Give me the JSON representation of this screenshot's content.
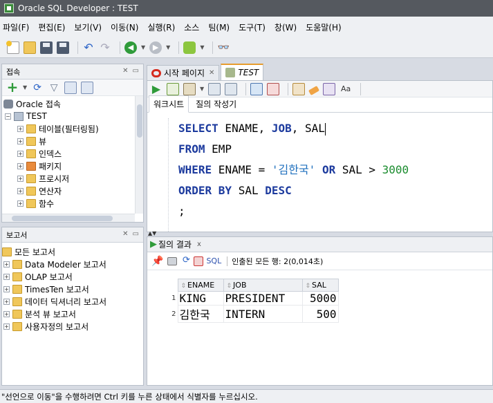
{
  "window": {
    "title": "Oracle SQL Developer : TEST"
  },
  "menu": [
    "파일(F)",
    "편집(E)",
    "보기(V)",
    "이동(N)",
    "실행(R)",
    "소스",
    "팀(M)",
    "도구(T)",
    "창(W)",
    "도움말(H)"
  ],
  "connections_panel": {
    "title": "접속",
    "root": "Oracle 접속",
    "connection": "TEST",
    "items": [
      "테이블(필터링됨)",
      "뷰",
      "인덱스",
      "패키지",
      "프로시저",
      "연산자",
      "함수"
    ]
  },
  "reports_panel": {
    "title": "보고서",
    "root": "모든 보고서",
    "items": [
      "Data Modeler 보고서",
      "OLAP 보고서",
      "TimesTen 보고서",
      "데이터 딕셔너리 보고서",
      "분석 뷰 보고서",
      "사용자정의 보고서"
    ]
  },
  "doc_tabs": [
    {
      "label": "시작 페이지",
      "active": false
    },
    {
      "label": "TEST",
      "active": true
    }
  ],
  "sub_tabs": {
    "worksheet": "워크시트",
    "query_builder": "질의 작성기"
  },
  "editor": {
    "line1": {
      "kw1": "SELECT",
      "t1": " ENAME, ",
      "kw2": "JOB",
      "t2": ", SAL"
    },
    "line2": {
      "kw1": "FROM",
      "t1": " EMP"
    },
    "line3": {
      "kw1": "WHERE",
      "t1": " ENAME = ",
      "str": "'김한국'",
      "t2": " ",
      "kw2": "OR",
      "t3": " SAL > ",
      "num": "3000"
    },
    "line4": {
      "kw1": "ORDER BY",
      "t1": " SAL ",
      "kw2": "DESC"
    },
    "line5": ";"
  },
  "results": {
    "tab_label": "질의 결과",
    "tab_close": "x",
    "sql_label": "SQL",
    "fetch_info": "인출된 모든 행: 2(0,014초)",
    "columns": [
      "ENAME",
      "JOB",
      "SAL"
    ],
    "rows": [
      {
        "num": "1",
        "ename": "KING",
        "job": "PRESIDENT",
        "sal": "5000"
      },
      {
        "num": "2",
        "ename": "김한국",
        "job": "INTERN",
        "sal": "500"
      }
    ]
  },
  "status": "\"선언으로 이동\"을 수행하려면 Ctrl 키를 누른 상태에서 식별자를 누르십시오."
}
